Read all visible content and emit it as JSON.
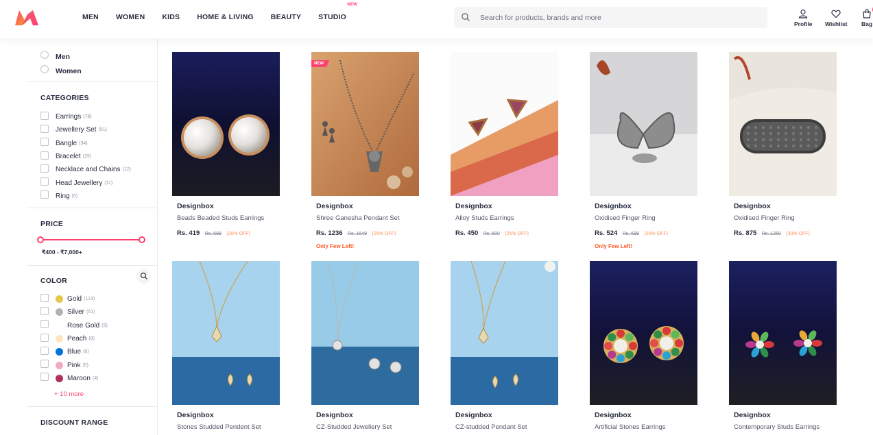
{
  "header": {
    "logo": "myntra-logo",
    "nav": [
      {
        "label": "MEN"
      },
      {
        "label": "WOMEN"
      },
      {
        "label": "KIDS"
      },
      {
        "label": "HOME & LIVING"
      },
      {
        "label": "BEAUTY"
      },
      {
        "label": "STUDIO",
        "badge": "NEW"
      }
    ],
    "search": {
      "placeholder": "Search for products, brands and more",
      "value": ""
    },
    "actions": {
      "profile": "Profile",
      "wishlist": "Wishlist",
      "bag": "Bag",
      "bag_count": "1"
    }
  },
  "sidebar": {
    "gender": [
      {
        "label": "Men"
      },
      {
        "label": "Women"
      }
    ],
    "categories": {
      "title": "CATEGORIES",
      "items": [
        {
          "label": "Earrings",
          "count": "(78)"
        },
        {
          "label": "Jewellery Set",
          "count": "(51)"
        },
        {
          "label": "Bangle",
          "count": "(34)"
        },
        {
          "label": "Bracelet",
          "count": "(29)"
        },
        {
          "label": "Necklace and Chains",
          "count": "(12)"
        },
        {
          "label": "Head Jewellery",
          "count": "(11)"
        },
        {
          "label": "Ring",
          "count": "(5)"
        }
      ]
    },
    "price": {
      "title": "PRICE",
      "range": "₹400 - ₹7,000+",
      "min_fraction": 0,
      "max_fraction": 1
    },
    "color": {
      "title": "COLOR",
      "items": [
        {
          "label": "Gold",
          "count": "(123)",
          "swatch": "#e5c74a"
        },
        {
          "label": "Silver",
          "count": "(51)",
          "swatch": "#b3b3b3"
        },
        {
          "label": "Rose Gold",
          "count": "(9)",
          "swatch": "#fff"
        },
        {
          "label": "Peach",
          "count": "(8)",
          "swatch": "#ffe5bc"
        },
        {
          "label": "Blue",
          "count": "(6)",
          "swatch": "#0074d9"
        },
        {
          "label": "Pink",
          "count": "(5)",
          "swatch": "#f1a9c4"
        },
        {
          "label": "Maroon",
          "count": "(4)",
          "swatch": "#b03060"
        }
      ],
      "more": "+ 10 more"
    },
    "discount": {
      "title": "DISCOUNT RANGE"
    }
  },
  "products": [
    {
      "brand": "Designbox",
      "name": "Beads Beaded Studs Earrings",
      "price": "Rs. 419",
      "mrp": "Rs. 599",
      "off": "(30% OFF)",
      "few": "",
      "tag": "",
      "image": "pearl-stud-earrings"
    },
    {
      "brand": "Designbox",
      "name": "Shree Ganesha Pendant Set",
      "price": "Rs. 1236",
      "mrp": "Rs. 1649",
      "off": "(25% OFF)",
      "few": "Only Few Left!",
      "tag": "NEW",
      "image": "ganesha-pendant-necklace"
    },
    {
      "brand": "Designbox",
      "name": "Alloy Studs Earrings",
      "price": "Rs. 450",
      "mrp": "Rs. 600",
      "off": "(25% OFF)",
      "few": "",
      "tag": "",
      "image": "triangle-stud-earrings"
    },
    {
      "brand": "Designbox",
      "name": "Oxidised Finger Ring",
      "price": "Rs. 524",
      "mrp": "Rs. 699",
      "off": "(25% OFF)",
      "few": "Only Few Left!",
      "tag": "",
      "image": "butterfly-ring"
    },
    {
      "brand": "Designbox",
      "name": "Oxidised Finger Ring",
      "price": "Rs. 875",
      "mrp": "Rs. 1250",
      "off": "(30% OFF)",
      "few": "",
      "tag": "",
      "image": "oxidised-band-ring"
    },
    {
      "brand": "Designbox",
      "name": "Stones Studded Pendent Set",
      "price": "",
      "mrp": "",
      "off": "",
      "few": "",
      "tag": "",
      "image": "gold-drop-pendant-set"
    },
    {
      "brand": "Designbox",
      "name": "CZ-Studded Jewellery Set",
      "price": "",
      "mrp": "",
      "off": "",
      "few": "",
      "tag": "",
      "image": "silver-cz-pendant-set"
    },
    {
      "brand": "Designbox",
      "name": "CZ-studded Pendant Set",
      "price": "",
      "mrp": "",
      "off": "",
      "few": "",
      "tag": "",
      "image": "gold-cz-pendant-set"
    },
    {
      "brand": "Designbox",
      "name": "Artificial Stones Earrings",
      "price": "",
      "mrp": "",
      "off": "",
      "few": "",
      "tag": "",
      "image": "multicolor-flower-earrings"
    },
    {
      "brand": "Designbox",
      "name": "Contemporary Studs Earrings",
      "price": "",
      "mrp": "",
      "off": "",
      "few": "",
      "tag": "",
      "image": "star-stud-earrings"
    }
  ]
}
